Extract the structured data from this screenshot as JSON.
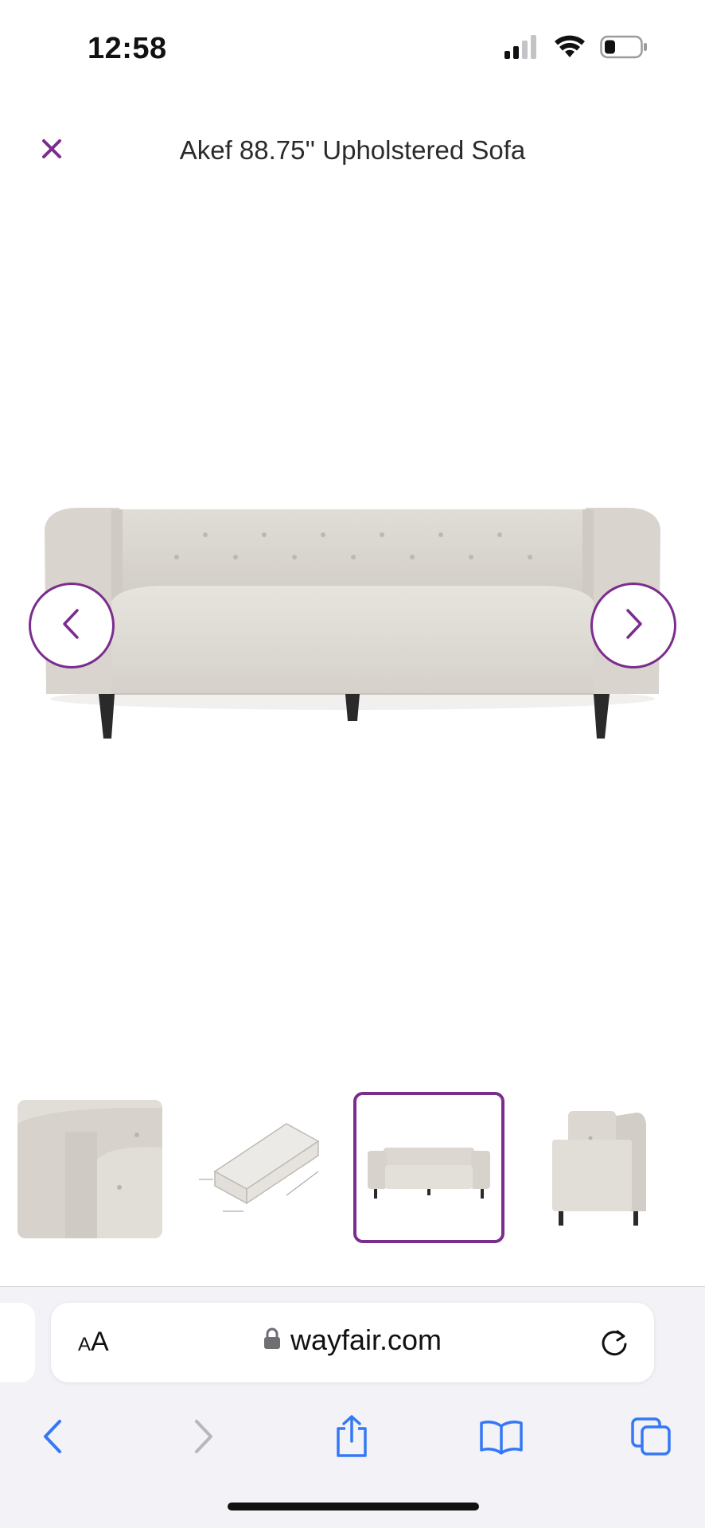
{
  "status_bar": {
    "time": "12:58",
    "icons": [
      "cellular-signal-icon",
      "wifi-icon",
      "battery-icon"
    ]
  },
  "header": {
    "close_icon": "close-icon",
    "title": "Akef 88.75'' Upholstered Sofa"
  },
  "gallery": {
    "prev_icon": "chevron-left-icon",
    "next_icon": "chevron-right-icon",
    "main_image": "sofa-front-view",
    "selected_thumbnail_index": 2,
    "thumbnails": [
      {
        "name": "thumbnail-arm-detail"
      },
      {
        "name": "thumbnail-dimensions"
      },
      {
        "name": "thumbnail-front-view"
      },
      {
        "name": "thumbnail-side-view"
      }
    ]
  },
  "browser": {
    "aa_label_small": "A",
    "aa_label_large": "A",
    "lock_icon": "lock-icon",
    "url": "wayfair.com",
    "reload_icon": "reload-icon",
    "toolbar": [
      "back-icon",
      "forward-icon",
      "share-icon",
      "bookmarks-icon",
      "tabs-icon"
    ]
  },
  "colors": {
    "accent": "#7b2d8e",
    "safari_blue": "#3478f6",
    "disabled_gray": "#b8b8bc"
  }
}
